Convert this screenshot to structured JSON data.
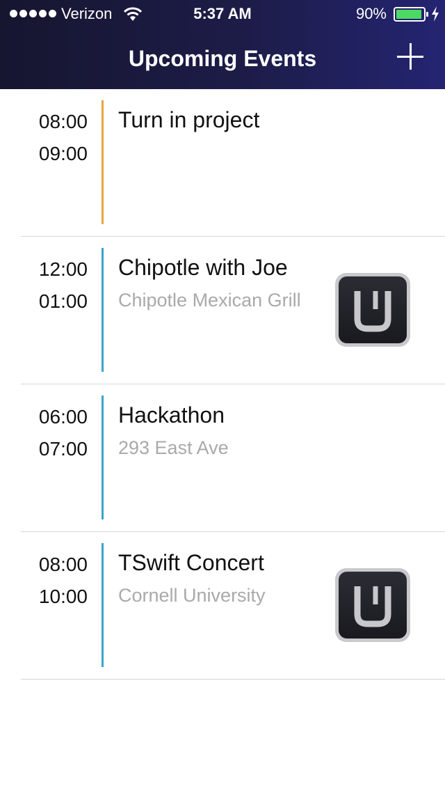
{
  "status_bar": {
    "carrier": "Verizon",
    "time": "5:37 AM",
    "battery": "90%"
  },
  "nav": {
    "title": "Upcoming Events"
  },
  "colors": {
    "accent_orange": "#e9a63a",
    "accent_blue": "#3aa4c8",
    "battery_green": "#4cd964"
  },
  "events": [
    {
      "start": "08:00",
      "end": "09:00",
      "title": "Turn in project",
      "location": "",
      "has_uber": false
    },
    {
      "start": "12:00",
      "end": "01:00",
      "title": "Chipotle with Joe",
      "location": "Chipotle Mexican Grill",
      "has_uber": true
    },
    {
      "start": "06:00",
      "end": "07:00",
      "title": "Hackathon",
      "location": "293 East Ave",
      "has_uber": false
    },
    {
      "start": "08:00",
      "end": "10:00",
      "title": "TSwift Concert",
      "location": "Cornell University",
      "has_uber": true
    }
  ]
}
